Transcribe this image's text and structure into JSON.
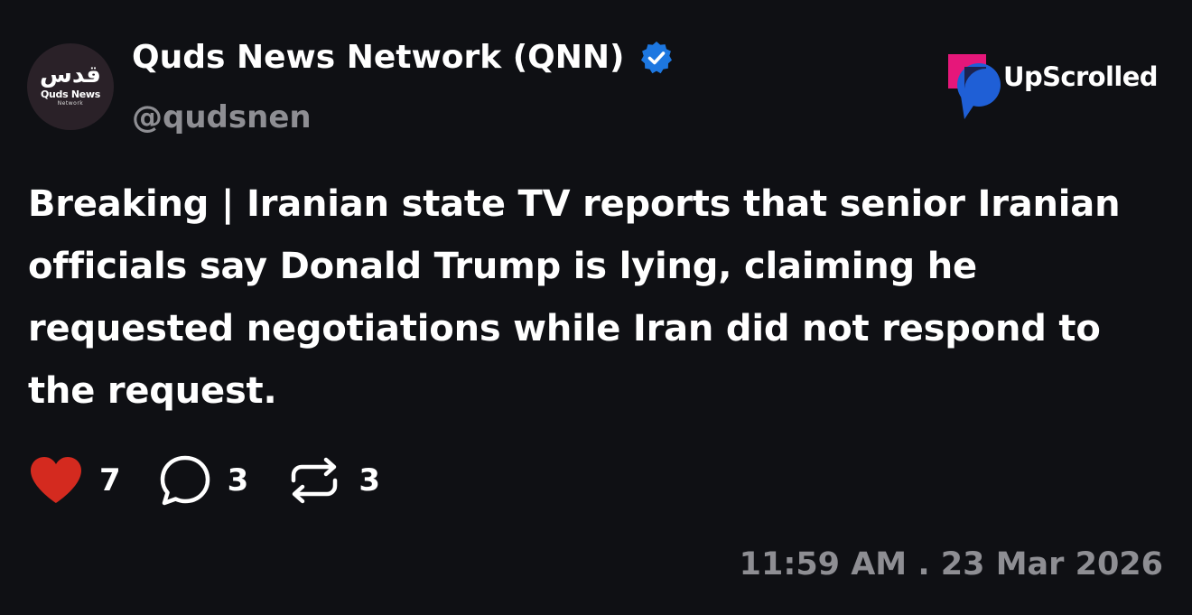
{
  "author": {
    "avatar_mark": "قدس",
    "avatar_name": "Quds News",
    "avatar_sub": "Network",
    "display_name": "Quds News Network (QNN)",
    "handle": "@qudsnen",
    "verified": true
  },
  "brand": {
    "name": "UpScrolled",
    "colors": {
      "pink": "#e6177a",
      "blue": "#1f5fd6",
      "navy": "#1b2350"
    }
  },
  "post": {
    "text": "Breaking | Iranian state TV reports that senior Iranian officials say Donald Trump is lying, claiming he requested negotiations while Iran did not respond to the request."
  },
  "stats": {
    "likes": "7",
    "comments": "3",
    "reposts": "3"
  },
  "icons": {
    "like": "heart-icon",
    "comment": "comment-bubble-icon",
    "repost": "repost-icon",
    "verified": "verified-badge-icon"
  },
  "colors": {
    "background": "#0f1014",
    "text": "#ffffff",
    "muted": "#8e8e93",
    "heart": "#d42a1f",
    "verified": "#1d77e0"
  },
  "timestamp": "11:59 AM . 23 Mar 2026"
}
